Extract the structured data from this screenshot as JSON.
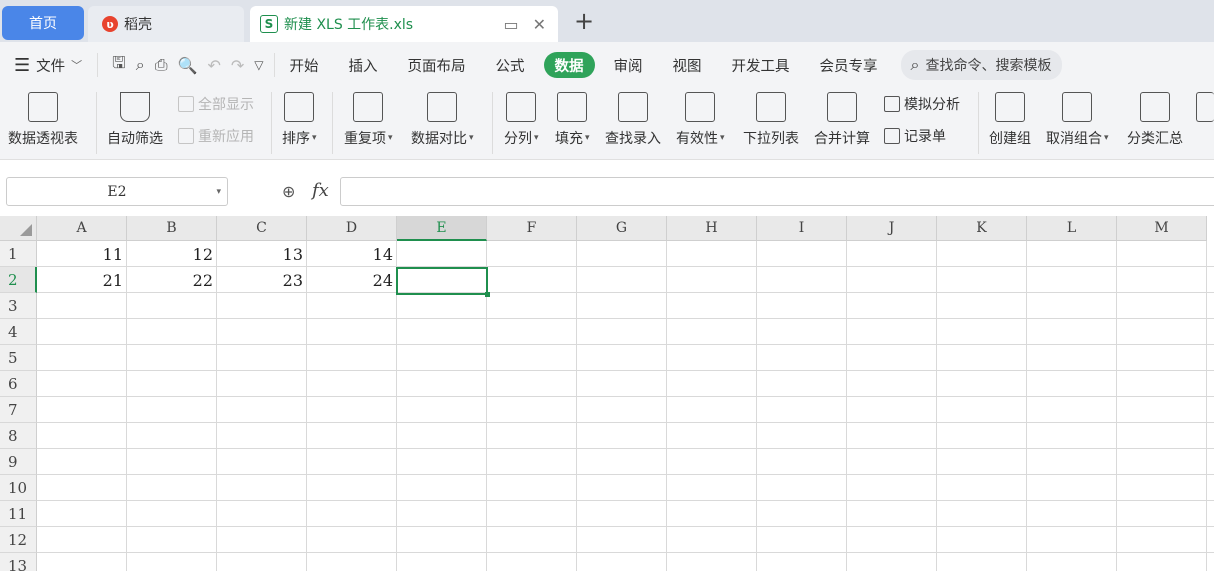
{
  "tabs": {
    "home": "首页",
    "daoke": "稻壳",
    "file": "新建 XLS 工作表.xls",
    "add": "+"
  },
  "menu": {
    "file": "文件",
    "items": [
      "开始",
      "插入",
      "页面布局",
      "公式",
      "数据",
      "审阅",
      "视图",
      "开发工具",
      "会员专享"
    ],
    "active": "数据",
    "search_placeholder": "查找命令、搜索模板"
  },
  "ribbon": {
    "pivot": "数据透视表",
    "autofilter": "自动筛选",
    "show_all": "全部显示",
    "reapply": "重新应用",
    "sort": "排序",
    "duplicates": "重复项",
    "compare": "数据对比",
    "split": "分列",
    "fill": "填充",
    "lookup": "查找录入",
    "validity": "有效性",
    "dropdown": "下拉列表",
    "consolidate": "合并计算",
    "whatif": "模拟分析",
    "record": "记录单",
    "group": "创建组",
    "ungroup": "取消组合",
    "subtotal": "分类汇总"
  },
  "formula": {
    "cell_ref": "E2",
    "fx": "fx",
    "content": ""
  },
  "sheet": {
    "columns": [
      "A",
      "B",
      "C",
      "D",
      "E",
      "F",
      "G",
      "H",
      "I",
      "J",
      "K",
      "L",
      "M"
    ],
    "rows": [
      "1",
      "2",
      "3",
      "4",
      "5",
      "6",
      "7",
      "8",
      "9",
      "10",
      "11",
      "12",
      "13"
    ],
    "selected_column": "E",
    "selected_row": "2",
    "values": [
      [
        "11",
        "12",
        "13",
        "14"
      ],
      [
        "21",
        "22",
        "23",
        "24"
      ]
    ]
  }
}
